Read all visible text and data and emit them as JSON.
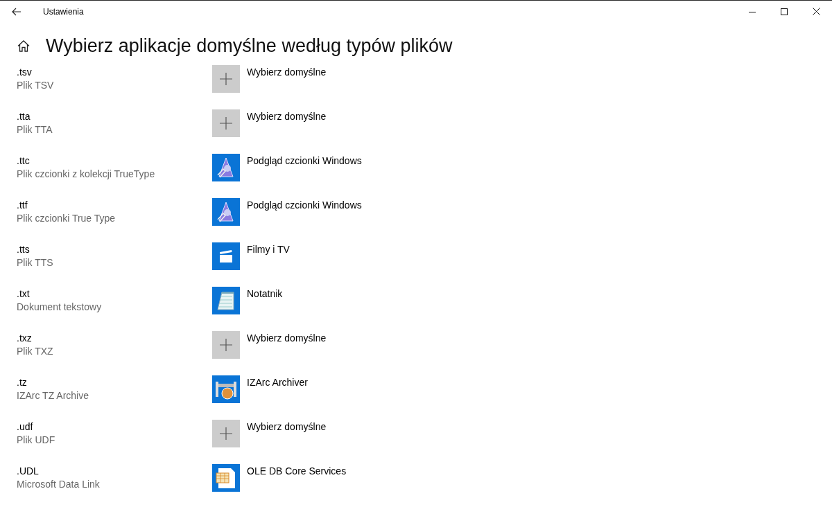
{
  "window": {
    "title": "Ustawienia"
  },
  "page": {
    "heading": "Wybierz aplikacje domyślne według typów plików"
  },
  "rows": [
    {
      "extension": ".tsv",
      "description": "Plik TSV",
      "app": {
        "kind": "choose",
        "name": "Wybierz domyślne"
      }
    },
    {
      "extension": ".tta",
      "description": "Plik TTA",
      "app": {
        "kind": "choose",
        "name": "Wybierz domyślne"
      }
    },
    {
      "extension": ".ttc",
      "description": "Plik czcionki z kolekcji TrueType",
      "app": {
        "kind": "font",
        "name": "Podgląd czcionki Windows"
      }
    },
    {
      "extension": ".ttf",
      "description": "Plik czcionki True Type",
      "app": {
        "kind": "font",
        "name": "Podgląd czcionki Windows"
      }
    },
    {
      "extension": ".tts",
      "description": "Plik TTS",
      "app": {
        "kind": "film",
        "name": "Filmy i TV"
      }
    },
    {
      "extension": ".txt",
      "description": "Dokument tekstowy",
      "app": {
        "kind": "notepad",
        "name": "Notatnik"
      }
    },
    {
      "extension": ".txz",
      "description": "Plik TXZ",
      "app": {
        "kind": "choose",
        "name": "Wybierz domyślne"
      }
    },
    {
      "extension": ".tz",
      "description": "IZArc TZ Archive",
      "app": {
        "kind": "archive",
        "name": "IZArc Archiver"
      }
    },
    {
      "extension": ".udf",
      "description": "Plik UDF",
      "app": {
        "kind": "choose",
        "name": "Wybierz domyślne"
      }
    },
    {
      "extension": ".UDL",
      "description": "Microsoft Data Link",
      "app": {
        "kind": "database",
        "name": "OLE DB Core Services"
      }
    }
  ]
}
